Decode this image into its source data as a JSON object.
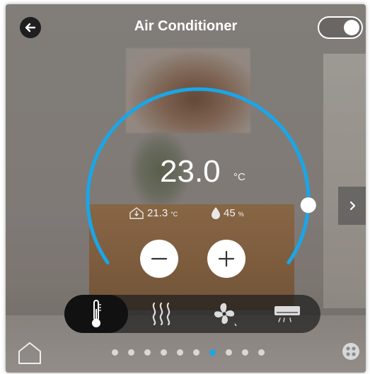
{
  "header": {
    "title": "Air Conditioner",
    "power_on": true
  },
  "dial": {
    "target_temperature": "23.0",
    "unit": "°C",
    "indoor_temperature": "21.3",
    "indoor_unit": "°C",
    "humidity": "45",
    "humidity_unit": "%"
  },
  "modes": [
    {
      "name": "cooling",
      "icon": "thermometer-icon",
      "selected": true
    },
    {
      "name": "heating",
      "icon": "heat-waves-icon",
      "selected": false
    },
    {
      "name": "fan",
      "icon": "fan-icon",
      "selected": false
    },
    {
      "name": "air-conditioner",
      "icon": "air-conditioner-icon",
      "selected": false
    }
  ],
  "pagination": {
    "count": 10,
    "active_index": 6
  },
  "colors": {
    "accent": "#1aa6e8",
    "dark": "#1f1f1f"
  }
}
